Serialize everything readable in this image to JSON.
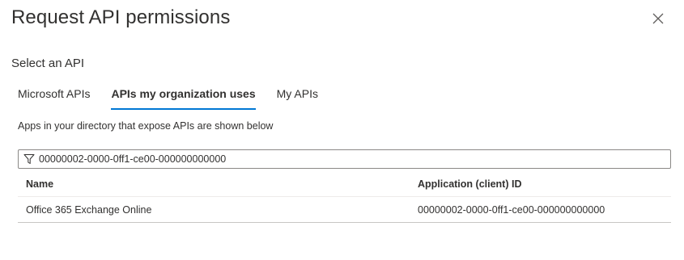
{
  "header": {
    "title": "Request API permissions",
    "close_icon": "close-icon"
  },
  "section": {
    "label": "Select an API"
  },
  "tabs": [
    {
      "label": "Microsoft APIs",
      "active": false
    },
    {
      "label": "APIs my organization uses",
      "active": true
    },
    {
      "label": "My APIs",
      "active": false
    }
  ],
  "helper_text": "Apps in your directory that expose APIs are shown below",
  "filter": {
    "icon": "filter-icon",
    "value": "00000002-0000-0ff1-ce00-000000000000"
  },
  "table": {
    "columns": [
      "Name",
      "Application (client) ID"
    ],
    "rows": [
      {
        "name": "Office 365 Exchange Online",
        "client_id": "00000002-0000-0ff1-ce00-000000000000"
      }
    ]
  },
  "colors": {
    "accent": "#0078d4",
    "text": "#323130",
    "border": "#8a8886"
  }
}
